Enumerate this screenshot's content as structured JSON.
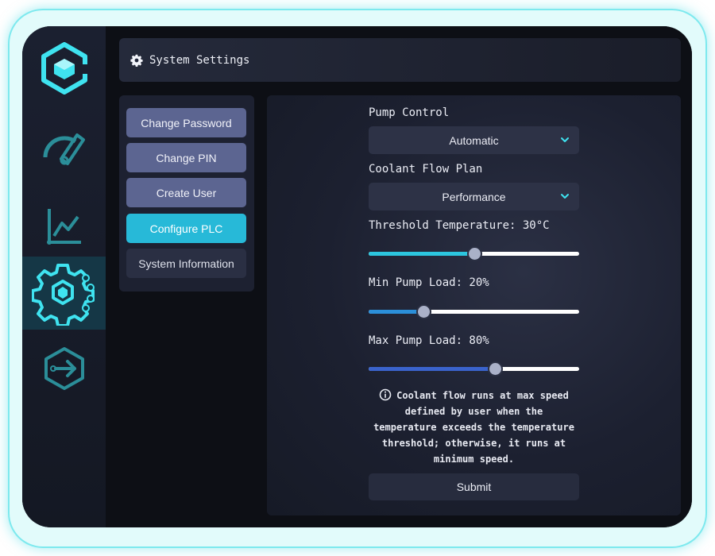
{
  "header": {
    "title": "System Settings",
    "icon": "gear-icon"
  },
  "sidebar": {
    "items": [
      {
        "name": "logo",
        "icon": "cube-logo-icon"
      },
      {
        "name": "dashboard",
        "icon": "gauge-icon"
      },
      {
        "name": "analytics",
        "icon": "line-chart-icon"
      },
      {
        "name": "settings",
        "icon": "settings-gear-icon",
        "active": true
      },
      {
        "name": "logout",
        "icon": "logout-arrow-icon"
      }
    ]
  },
  "menu": {
    "items": [
      {
        "label": "Change Password"
      },
      {
        "label": "Change PIN"
      },
      {
        "label": "Create User"
      },
      {
        "label": "Configure PLC",
        "active": true
      },
      {
        "label": "System Information"
      }
    ]
  },
  "form": {
    "pump_control": {
      "label": "Pump Control",
      "value": "Automatic"
    },
    "coolant_flow": {
      "label": "Coolant Flow Plan",
      "value": "Performance"
    },
    "threshold": {
      "label": "Threshold Temperature: 30°C",
      "fraction": 0.5
    },
    "min_load": {
      "label": "Min Pump Load: 20%",
      "fraction": 0.26
    },
    "max_load": {
      "label": "Max Pump Load: 80%",
      "fraction": 0.6
    },
    "info_lines": [
      "Coolant flow runs at max speed",
      "defined by user when the",
      "temperature exceeds the temperature",
      "threshold; otherwise, it runs at",
      "minimum speed."
    ],
    "submit_label": "Submit"
  },
  "colors": {
    "accent": "#27b9d8",
    "slider_fill_1": "#2cc6df",
    "slider_fill_2": "#2b8fd9",
    "slider_fill_3": "#3a63cc",
    "icon_cyan": "#3fe3f0",
    "icon_teal": "#2b8e99"
  }
}
